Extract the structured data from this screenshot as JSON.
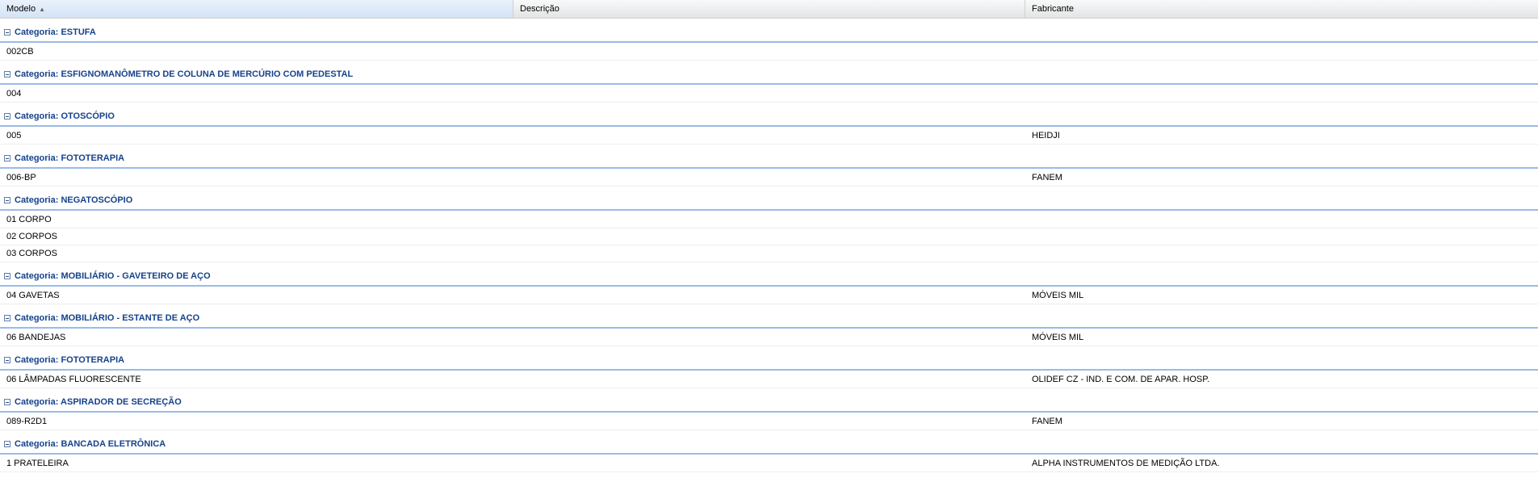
{
  "columns": {
    "model": "Modelo",
    "description": "Descrição",
    "manufacturer": "Fabricante"
  },
  "groups": [
    {
      "label": "Categoria: ESTUFA",
      "rows": [
        {
          "model": "002CB",
          "description": "",
          "manufacturer": ""
        }
      ]
    },
    {
      "label": "Categoria: ESFIGNOMANÔMETRO DE COLUNA DE MERCÚRIO COM PEDESTAL",
      "rows": [
        {
          "model": "004",
          "description": "",
          "manufacturer": ""
        }
      ]
    },
    {
      "label": "Categoria: OTOSCÓPIO",
      "rows": [
        {
          "model": "005",
          "description": "",
          "manufacturer": "HEIDJI"
        }
      ]
    },
    {
      "label": "Categoria: FOTOTERAPIA",
      "rows": [
        {
          "model": "006-BP",
          "description": "",
          "manufacturer": "FANEM"
        }
      ]
    },
    {
      "label": "Categoria: NEGATOSCÓPIO",
      "rows": [
        {
          "model": "01 CORPO",
          "description": "",
          "manufacturer": ""
        },
        {
          "model": "02 CORPOS",
          "description": "",
          "manufacturer": ""
        },
        {
          "model": "03 CORPOS",
          "description": "",
          "manufacturer": ""
        }
      ]
    },
    {
      "label": "Categoria: MOBILIÁRIO - GAVETEIRO DE AÇO",
      "rows": [
        {
          "model": "04 GAVETAS",
          "description": "",
          "manufacturer": "MÓVEIS MIL"
        }
      ]
    },
    {
      "label": "Categoria: MOBILIÁRIO - ESTANTE DE AÇO",
      "rows": [
        {
          "model": "06 BANDEJAS",
          "description": "",
          "manufacturer": "MÓVEIS MIL"
        }
      ]
    },
    {
      "label": "Categoria: FOTOTERAPIA",
      "rows": [
        {
          "model": "06 LÂMPADAS FLUORESCENTE",
          "description": "",
          "manufacturer": "OLIDEF CZ - IND. E COM. DE APAR. HOSP."
        }
      ]
    },
    {
      "label": "Categoria: ASPIRADOR DE SECREÇÃO",
      "rows": [
        {
          "model": "089-R2D1",
          "description": "",
          "manufacturer": "FANEM"
        }
      ]
    },
    {
      "label": "Categoria: BANCADA ELETRÔNICA",
      "rows": [
        {
          "model": "1 PRATELEIRA",
          "description": "",
          "manufacturer": "ALPHA INSTRUMENTOS DE MEDIÇÃO LTDA."
        }
      ]
    }
  ],
  "colors": {
    "group_text": "#15428b",
    "group_line": "#99bbe8",
    "sorted_header": "#d3e3f7"
  },
  "icons": {
    "sort": "sort-ascending-icon",
    "collapse": "collapse-group-icon"
  }
}
